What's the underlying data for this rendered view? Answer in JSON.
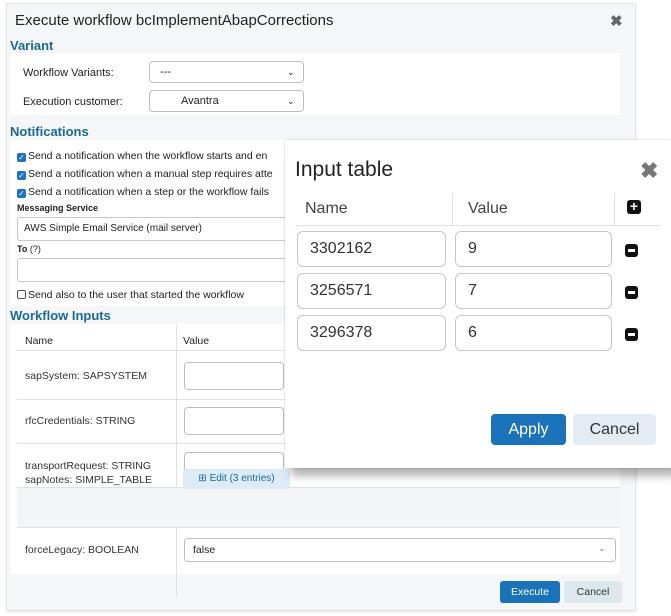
{
  "dialog": {
    "title": "Execute workflow bcImplementAbapCorrections",
    "close_icon": "✖"
  },
  "variant": {
    "heading": "Variant",
    "workflow_variants_label": "Workflow Variants:",
    "workflow_variants_value": "---",
    "execution_customer_label": "Execution customer:",
    "execution_customer_value": "Avantra"
  },
  "notifications": {
    "heading": "Notifications",
    "options": [
      {
        "label": "Send a notification when the workflow starts and en",
        "checked": true
      },
      {
        "label": "Send a notification when a manual step requires atte",
        "checked": true
      },
      {
        "label": "Send a notification when a step or the workflow fails",
        "checked": true
      }
    ],
    "messaging_service_label": "Messaging Service",
    "messaging_service_value": "AWS Simple Email Service (mail server)",
    "to_label": "To",
    "to_hint": "(?)",
    "to_value": "",
    "send_to_starter": {
      "label": "Send also to the user that started the workflow",
      "checked": false
    }
  },
  "workflow_inputs": {
    "heading": "Workflow Inputs",
    "columns": {
      "name": "Name",
      "value": "Value"
    },
    "rows": [
      {
        "name": "sapSystem: SAPSYSTEM"
      },
      {
        "name": "rfcCredentials: STRING"
      },
      {
        "name": "transportRequest: STRING"
      },
      {
        "name": "sapNotes: SIMPLE_TABLE",
        "edit_label": "⊞ Edit (3 entries)"
      },
      {
        "name": "forceLegacy: BOOLEAN",
        "value": "false"
      }
    ]
  },
  "actions": {
    "execute": "Execute",
    "cancel": "Cancel"
  },
  "input_table": {
    "title": "Input table",
    "close_icon": "✖",
    "columns": {
      "name": "Name",
      "value": "Value"
    },
    "add_icon": "+",
    "rows": [
      {
        "name": "3302162",
        "value": "9"
      },
      {
        "name": "3256571",
        "value": "7"
      },
      {
        "name": "3296378",
        "value": "6"
      }
    ],
    "apply": "Apply",
    "cancel": "Cancel"
  },
  "colors": {
    "accent": "#1a73b8",
    "section_heading": "#1a6a9a",
    "dialog_bg": "#f5f6f7"
  }
}
